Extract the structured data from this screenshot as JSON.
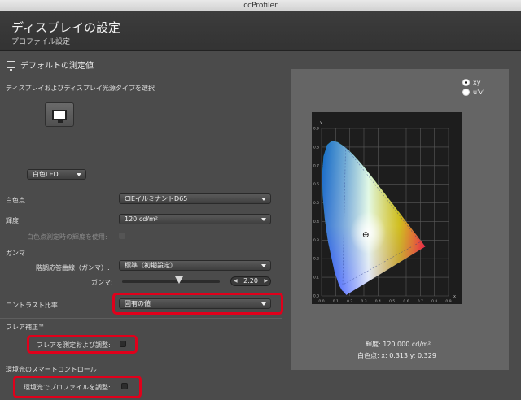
{
  "window": {
    "title": "ccProfiler"
  },
  "header": {
    "title": "ディスプレイの設定",
    "subtitle": "プロファイル設定"
  },
  "section": {
    "title": "デフォルトの測定値"
  },
  "display_type": {
    "label": "ディスプレイおよびディスプレイ光源タイプを選択",
    "selected": "白色LED"
  },
  "white_point": {
    "label": "白色点",
    "value": "CIEイルミナントD65"
  },
  "luminance": {
    "label": "輝度",
    "value": "120 cd/m²",
    "use_measured_label": "白色点測定時の輝度を使用:"
  },
  "gamma": {
    "label": "ガンマ",
    "curve_label": "階調応答曲線（ガンマ）:",
    "curve_value": "標準（初期設定）",
    "gamma_label": "ガンマ:",
    "gamma_value": "2.20"
  },
  "contrast": {
    "label": "コントラスト比率",
    "value": "固有の値"
  },
  "flare": {
    "label": "フレア補正™",
    "checkbox_label": "フレアを測定および調整:"
  },
  "ambient": {
    "label": "環境光のスマートコントロール",
    "checkbox_label": "環境光でプロファイルを調整:"
  },
  "chart_panel": {
    "radio_xy": "xy",
    "radio_uv": "u'v'",
    "selected": "xy",
    "luminance_text": "輝度:   120.000 cd/m²",
    "whitepoint_text": "白色点:   x: 0.313  y: 0.329"
  },
  "chart_data": {
    "type": "scatter",
    "title": "",
    "xlabel": "x",
    "ylabel": "y",
    "xlim": [
      0,
      0.9
    ],
    "ylim": [
      0,
      0.9
    ],
    "x_ticks": [
      "0.0",
      "0.1",
      "0.2",
      "0.3",
      "0.4",
      "0.5",
      "0.6",
      "0.7",
      "0.8",
      "0.9"
    ],
    "y_ticks": [
      "0.0",
      "0.1",
      "0.2",
      "0.3",
      "0.4",
      "0.5",
      "0.6",
      "0.7",
      "0.8",
      "0.9"
    ],
    "grid": true,
    "gamut_triangle": [
      [
        0.7,
        0.29
      ],
      [
        0.17,
        0.8
      ],
      [
        0.15,
        0.06
      ]
    ],
    "white_point": [
      0.313,
      0.329
    ]
  }
}
